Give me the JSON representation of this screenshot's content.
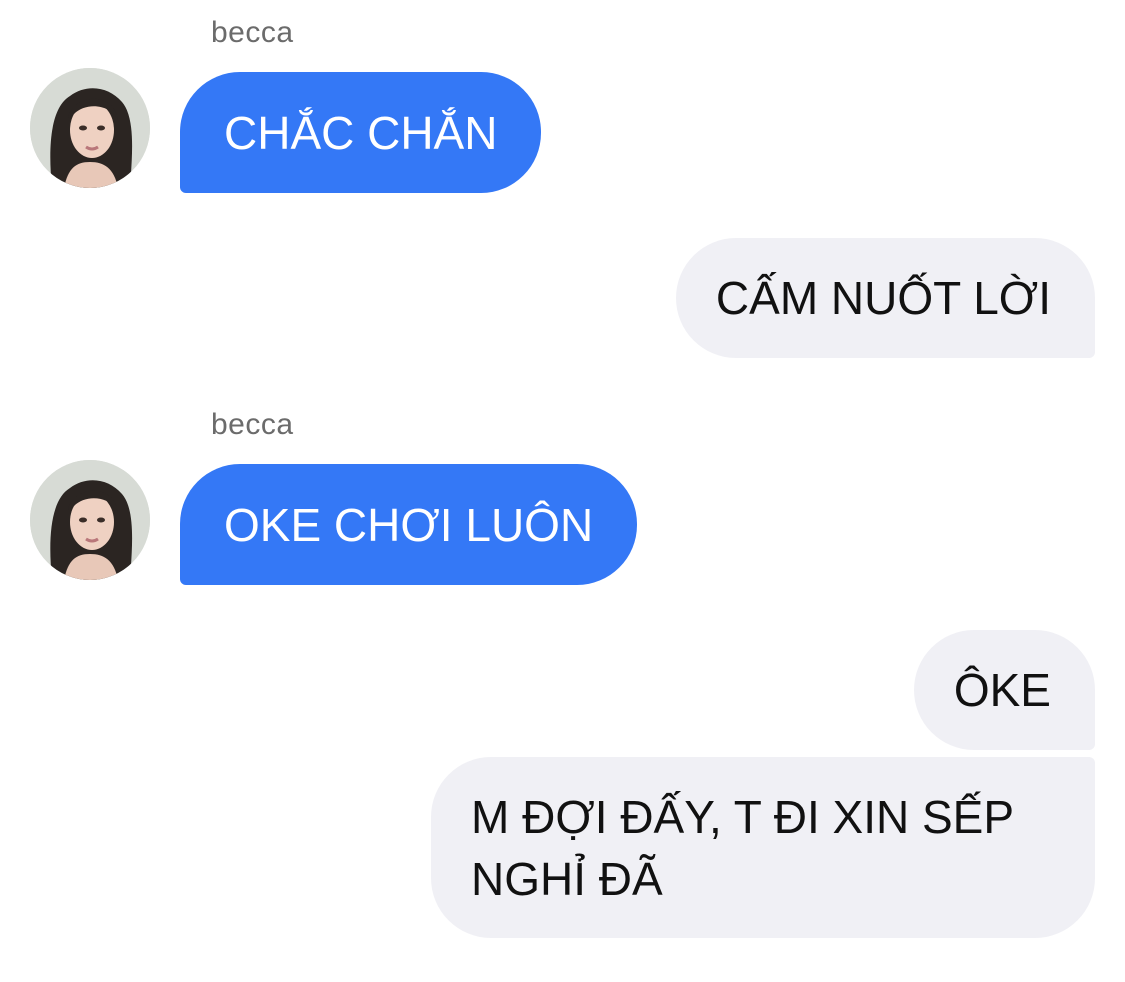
{
  "messages": [
    {
      "sender": "becca",
      "direction": "incoming",
      "text": "CHẮC CHẮN"
    },
    {
      "direction": "outgoing",
      "text": "CẤM NUỐT LỜI"
    },
    {
      "sender": "becca",
      "direction": "incoming",
      "text": "OKE CHƠI LUÔN"
    },
    {
      "direction": "outgoing",
      "text": "ÔKE"
    },
    {
      "direction": "outgoing",
      "lines": [
        "M ĐỢI ĐẤY, T ĐI XIN SẾP",
        "NGHỈ ĐÃ"
      ]
    }
  ],
  "colors": {
    "incoming_bubble": "#3478f6",
    "outgoing_bubble": "#f0f0f5",
    "sender_name": "#6b6b6b"
  },
  "icons": {
    "avatar": "contact-avatar"
  }
}
